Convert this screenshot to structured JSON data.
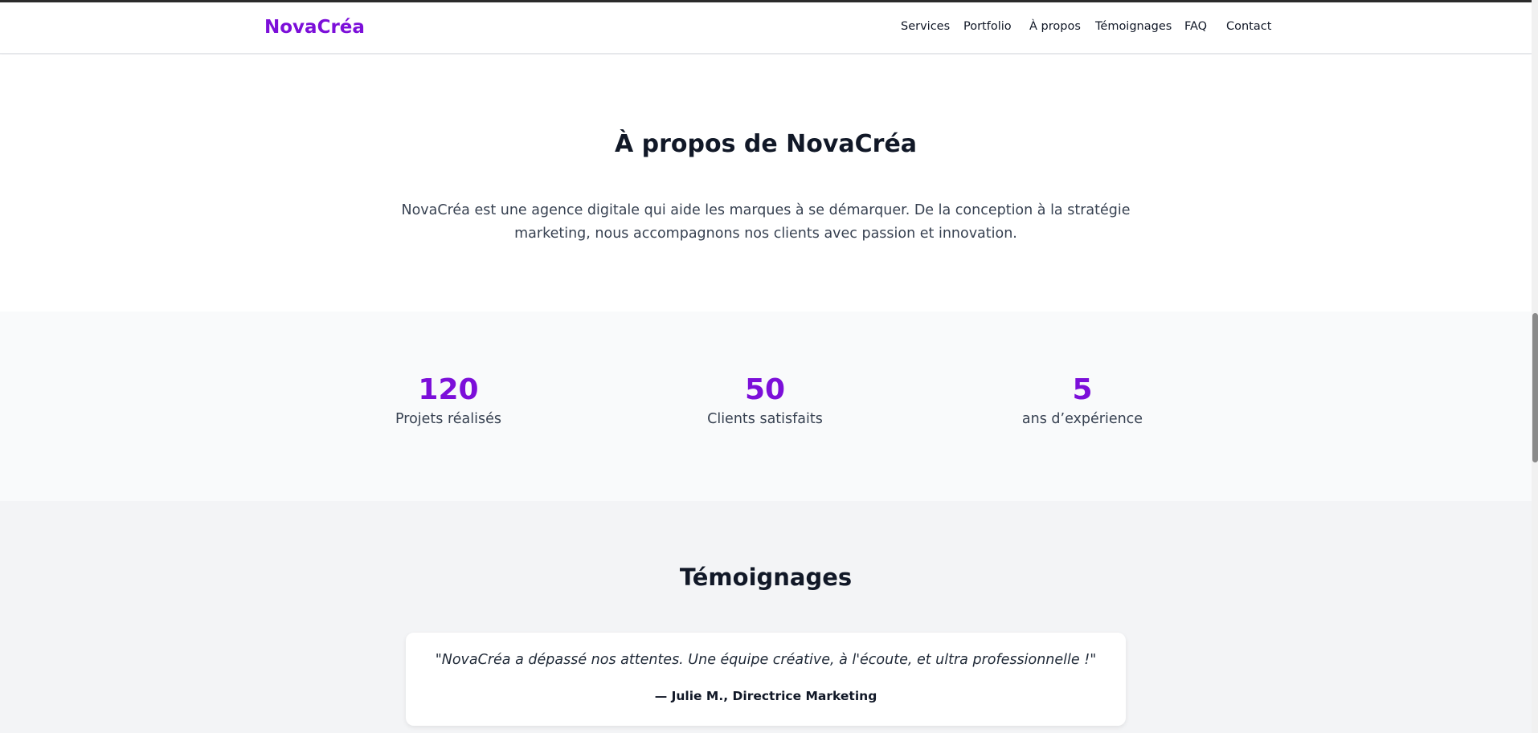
{
  "header": {
    "logo": "NovaCréa",
    "nav": [
      "Services",
      "Portfolio",
      "À propos",
      "Témoignages",
      "FAQ",
      "Contact"
    ]
  },
  "about": {
    "title": "À propos de NovaCréa",
    "text": "NovaCréa est une agence digitale qui aide les marques à se démarquer. De la conception à la stratégie marketing, nous accompagnons nos clients avec passion et innovation."
  },
  "stats": [
    {
      "value": "120",
      "label": "Projets réalisés"
    },
    {
      "value": "50",
      "label": "Clients satisfaits"
    },
    {
      "value": "5",
      "label": "ans d’expérience"
    }
  ],
  "testimonials": {
    "title": "Témoignages",
    "items": [
      {
        "quote": "\"NovaCréa a dépassé nos attentes. Une équipe créative, à l'écoute, et ultra professionnelle !\"",
        "author": "— Julie M., Directrice Marketing"
      }
    ]
  },
  "colors": {
    "accent": "#7c0fd9",
    "text": "#111827",
    "muted": "#374151"
  }
}
